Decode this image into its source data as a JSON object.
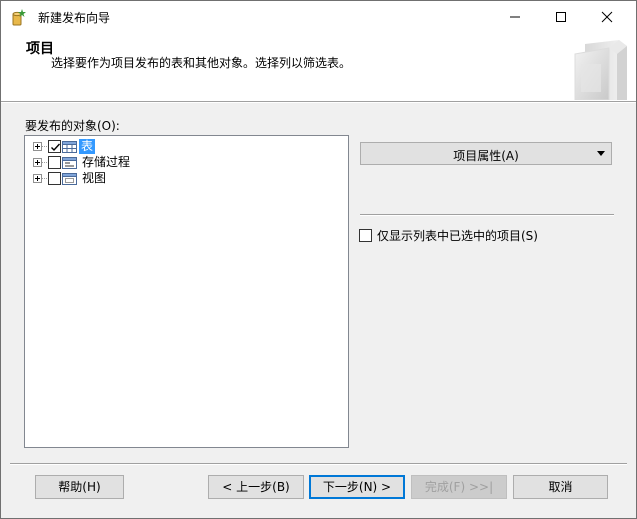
{
  "window": {
    "title": "新建发布向导"
  },
  "header": {
    "title": "项目",
    "description": "选择要作为项目发布的表和其他对象。选择列以筛选表。"
  },
  "objects": {
    "label": "要发布的对象(O):",
    "tree": [
      {
        "label": "表",
        "checked": true,
        "selected": true,
        "icon": "table-icon"
      },
      {
        "label": "存储过程",
        "checked": false,
        "selected": false,
        "icon": "stored-procedure-icon"
      },
      {
        "label": "视图",
        "checked": false,
        "selected": false,
        "icon": "view-icon"
      }
    ]
  },
  "properties": {
    "dropdown_label": "项目属性(A)",
    "show_only_label": "仅显示列表中已选中的项目(S)",
    "show_only_checked": false
  },
  "buttons": {
    "help": "帮助(H)",
    "back": "< 上一步(B)",
    "next": "下一步(N) >",
    "finish": "完成(F) >>|",
    "cancel": "取消"
  },
  "colors": {
    "selection": "#3399ff",
    "accent": "#0078d7",
    "dialog_bg": "#f0f0f0"
  }
}
